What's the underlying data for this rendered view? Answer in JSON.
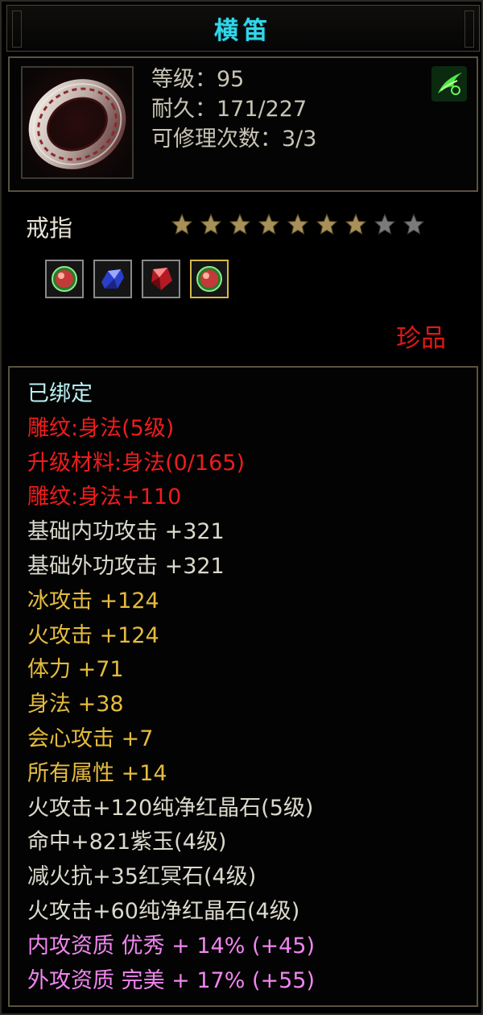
{
  "header": {
    "title": "横笛"
  },
  "item": {
    "level_line": "等级：95",
    "durability_line": "耐久：171/227",
    "repair_line": "可修理次数：3/3",
    "icon": "silver-ring-icon",
    "emblem_icon": "green-cloud-emblem-icon"
  },
  "meta": {
    "type_name": "戒指",
    "stars_filled": 7,
    "stars_total": 9,
    "rarity": "珍品"
  },
  "gems": [
    {
      "icon": "green-red-gem-icon"
    },
    {
      "icon": "blue-crystal-icon"
    },
    {
      "icon": "red-crystal-icon"
    },
    {
      "icon": "green-red-gem-selected-icon",
      "selected": true
    }
  ],
  "attributes": [
    {
      "text": "已绑定",
      "color": "cyan"
    },
    {
      "text": "雕纹:身法(5级)",
      "color": "red"
    },
    {
      "text": "升级材料:身法(0/165)",
      "color": "red"
    },
    {
      "text": "雕纹:身法+110",
      "color": "red"
    },
    {
      "text": "基础内功攻击 +321",
      "color": "white"
    },
    {
      "text": "基础外功攻击 +321",
      "color": "white"
    },
    {
      "text": "冰攻击 +124",
      "color": "gold"
    },
    {
      "text": "火攻击 +124",
      "color": "gold"
    },
    {
      "text": "体力 +71",
      "color": "gold"
    },
    {
      "text": "身法 +38",
      "color": "gold"
    },
    {
      "text": "会心攻击 +7",
      "color": "gold"
    },
    {
      "text": "所有属性 +14",
      "color": "gold"
    },
    {
      "text": "火攻击+120纯净红晶石(5级)",
      "color": "white"
    },
    {
      "text": "命中+821紫玉(4级)",
      "color": "white"
    },
    {
      "text": "减火抗+35红冥石(4级)",
      "color": "white"
    },
    {
      "text": "火攻击+60纯净红晶石(4级)",
      "color": "white"
    },
    {
      "text": "内攻资质 优秀 + 14% (+45)",
      "color": "pink"
    },
    {
      "text": "外攻资质 完美 + 17% (+55)",
      "color": "pink"
    }
  ],
  "colors": {
    "title": "#31d6e8",
    "cyan": "#b9f1f4",
    "red": "#ef1c1c",
    "white": "#dcd9cc",
    "gold": "#e5bb3e",
    "pink": "#ef86ee",
    "star_filled": "#a8905a",
    "star_empty": "#7a7a7a"
  }
}
